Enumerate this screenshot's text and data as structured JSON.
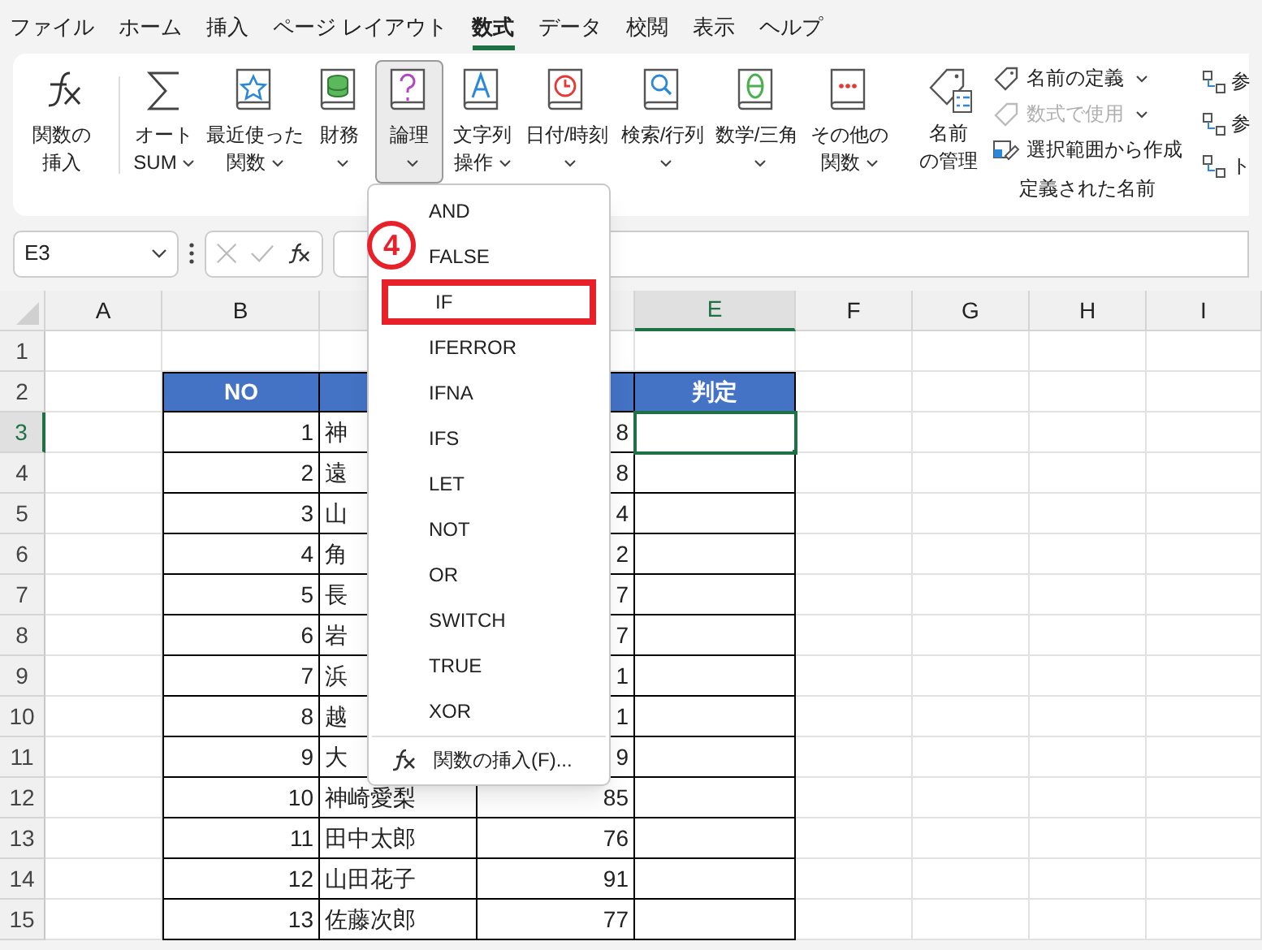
{
  "menu_tabs": [
    {
      "label": "ファイル",
      "selected": false
    },
    {
      "label": "ホーム",
      "selected": false
    },
    {
      "label": "挿入",
      "selected": false
    },
    {
      "label": "ページ レイアウト",
      "selected": false
    },
    {
      "label": "数式",
      "selected": true
    },
    {
      "label": "データ",
      "selected": false
    },
    {
      "label": "校閲",
      "selected": false
    },
    {
      "label": "表示",
      "selected": false
    },
    {
      "label": "ヘルプ",
      "selected": false
    }
  ],
  "ribbon": {
    "buttons": [
      {
        "lines": [
          "関数の",
          "挿入"
        ],
        "dropdown": false,
        "selected": false
      },
      {
        "lines": [
          "オート",
          "SUM"
        ],
        "dropdown": true,
        "selected": false
      },
      {
        "lines": [
          "最近使った",
          "関数"
        ],
        "dropdown": true,
        "selected": false
      },
      {
        "lines": [
          "財務"
        ],
        "dropdown": true,
        "selected": false
      },
      {
        "lines": [
          "論理"
        ],
        "dropdown": true,
        "selected": true
      },
      {
        "lines": [
          "文字列",
          "操作"
        ],
        "dropdown": true,
        "selected": false
      },
      {
        "lines": [
          "日付/時刻"
        ],
        "dropdown": true,
        "selected": false
      },
      {
        "lines": [
          "検索/行列"
        ],
        "dropdown": true,
        "selected": false
      },
      {
        "lines": [
          "数学/三角"
        ],
        "dropdown": true,
        "selected": false
      },
      {
        "lines": [
          "その他の",
          "関数"
        ],
        "dropdown": true,
        "selected": false
      }
    ],
    "names_group": {
      "manage_lines": [
        "名前",
        "の管理"
      ],
      "items": [
        {
          "label": "名前の定義",
          "disabled": false,
          "dropdown": true
        },
        {
          "label": "数式で使用",
          "disabled": true,
          "dropdown": true
        },
        {
          "label": "選択範囲から作成",
          "disabled": false,
          "dropdown": false
        }
      ],
      "group_label": "定義された名前"
    },
    "audit_items": [
      "参",
      "参",
      "ト"
    ]
  },
  "formula_bar": {
    "name_box": "E3"
  },
  "sheet": {
    "columns": [
      {
        "label": "A",
        "selected": false
      },
      {
        "label": "B",
        "selected": false
      },
      {},
      {},
      {
        "label": "E",
        "selected": true
      },
      {
        "label": "F",
        "selected": false
      },
      {
        "label": "G",
        "selected": false
      },
      {
        "label": "H",
        "selected": false
      },
      {
        "label": "I",
        "selected": false
      }
    ],
    "rows": [
      {
        "number": "1",
        "kind": "blank",
        "selected": false,
        "cells": {}
      },
      {
        "number": "2",
        "kind": "header",
        "selected": false,
        "cells": {
          "B": "NO",
          "E": "判定"
        }
      },
      {
        "number": "3",
        "kind": "data",
        "selected": true,
        "cells": {
          "B": "1",
          "C": "神",
          "D": "8"
        }
      },
      {
        "number": "4",
        "kind": "data",
        "selected": false,
        "cells": {
          "B": "2",
          "C": "遠",
          "D": "8"
        }
      },
      {
        "number": "5",
        "kind": "data",
        "selected": false,
        "cells": {
          "B": "3",
          "C": "山",
          "D": "4"
        }
      },
      {
        "number": "6",
        "kind": "data",
        "selected": false,
        "cells": {
          "B": "4",
          "C": "角",
          "D": "2"
        }
      },
      {
        "number": "7",
        "kind": "data",
        "selected": false,
        "cells": {
          "B": "5",
          "C": "長",
          "D": "7"
        }
      },
      {
        "number": "8",
        "kind": "data",
        "selected": false,
        "cells": {
          "B": "6",
          "C": "岩",
          "D": "7"
        }
      },
      {
        "number": "9",
        "kind": "data",
        "selected": false,
        "cells": {
          "B": "7",
          "C": "浜",
          "D": "1"
        }
      },
      {
        "number": "10",
        "kind": "data",
        "selected": false,
        "cells": {
          "B": "8",
          "C": "越",
          "D": "1"
        }
      },
      {
        "number": "11",
        "kind": "data",
        "selected": false,
        "cells": {
          "B": "9",
          "C": "大",
          "D": "9"
        }
      },
      {
        "number": "12",
        "kind": "data",
        "selected": false,
        "cells": {
          "B": "10",
          "C": "神崎愛梨",
          "D": "85"
        }
      },
      {
        "number": "13",
        "kind": "data",
        "selected": false,
        "cells": {
          "B": "11",
          "C": "田中太郎",
          "D": "76"
        }
      },
      {
        "number": "14",
        "kind": "data",
        "selected": false,
        "cells": {
          "B": "12",
          "C": "山田花子",
          "D": "91"
        }
      },
      {
        "number": "15",
        "kind": "data",
        "selected": false,
        "cells": {
          "B": "13",
          "C": "佐藤次郎",
          "D": "77"
        }
      }
    ]
  },
  "dropdown_menu": {
    "items": [
      {
        "label": "AND",
        "highlighted": false
      },
      {
        "label": "FALSE",
        "highlighted": false
      },
      {
        "label": "IF",
        "highlighted": true
      },
      {
        "label": "IFERROR",
        "highlighted": false
      },
      {
        "label": "IFNA",
        "highlighted": false
      },
      {
        "label": "IFS",
        "highlighted": false
      },
      {
        "label": "LET",
        "highlighted": false
      },
      {
        "label": "NOT",
        "highlighted": false
      },
      {
        "label": "OR",
        "highlighted": false
      },
      {
        "label": "SWITCH",
        "highlighted": false
      },
      {
        "label": "TRUE",
        "highlighted": false
      },
      {
        "label": "XOR",
        "highlighted": false
      }
    ],
    "footer": "関数の挿入(F)..."
  },
  "annotation": {
    "step": "4"
  }
}
